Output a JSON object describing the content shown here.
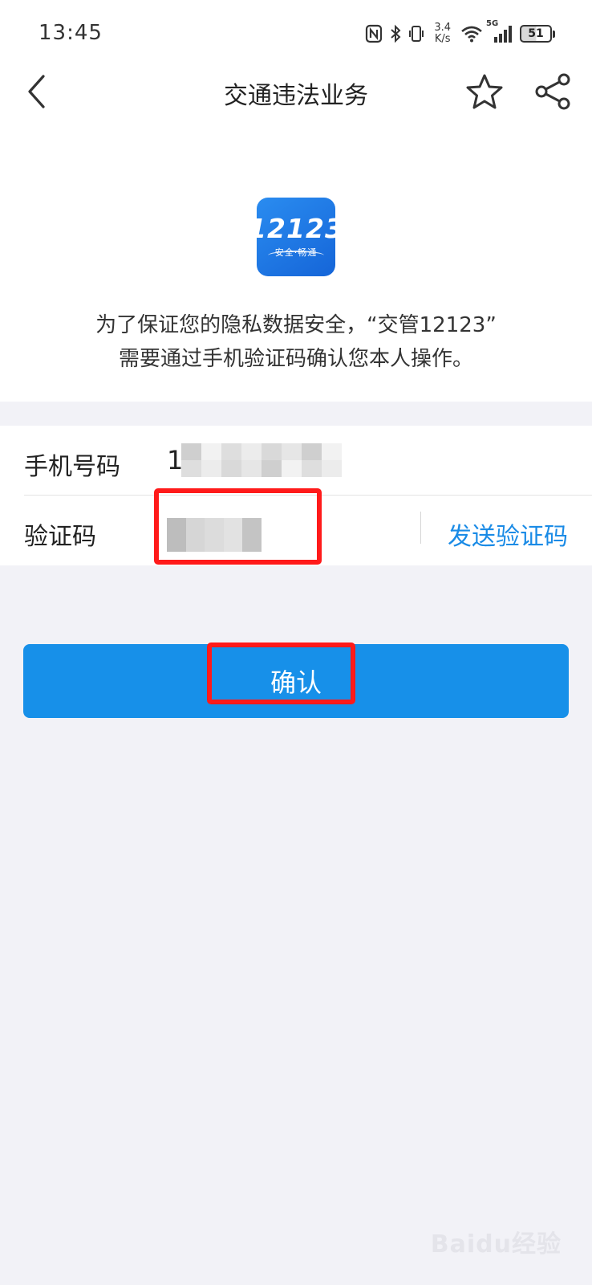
{
  "status_bar": {
    "time": "13:45",
    "net_speed_value": "3.4",
    "net_speed_unit": "K/s",
    "network_type": "5G",
    "battery_level": "51",
    "icons": [
      "nfc-icon",
      "bluetooth-icon",
      "vibrate-icon",
      "wifi-icon",
      "signal-icon",
      "battery-icon"
    ]
  },
  "nav": {
    "title": "交通违法业务",
    "icons": [
      "back-arrow-icon",
      "star-icon",
      "share-icon"
    ]
  },
  "app_logo": {
    "number": "12123",
    "subtitle": "安全·畅通"
  },
  "intro": {
    "line1": "为了保证您的隐私数据安全，“交管12123”",
    "line2": "需要通过手机验证码确认您本人操作。"
  },
  "form": {
    "phone_label": "手机号码",
    "phone_value_visible": "1",
    "code_label": "验证码",
    "send_code": "发送验证码"
  },
  "confirm": {
    "label": "确认"
  },
  "watermark": "Baidu经验",
  "colors": {
    "accent": "#1790e9",
    "link": "#1a8be6",
    "annotation": "#ff1a1a",
    "page_background": "#f2f2f7"
  }
}
